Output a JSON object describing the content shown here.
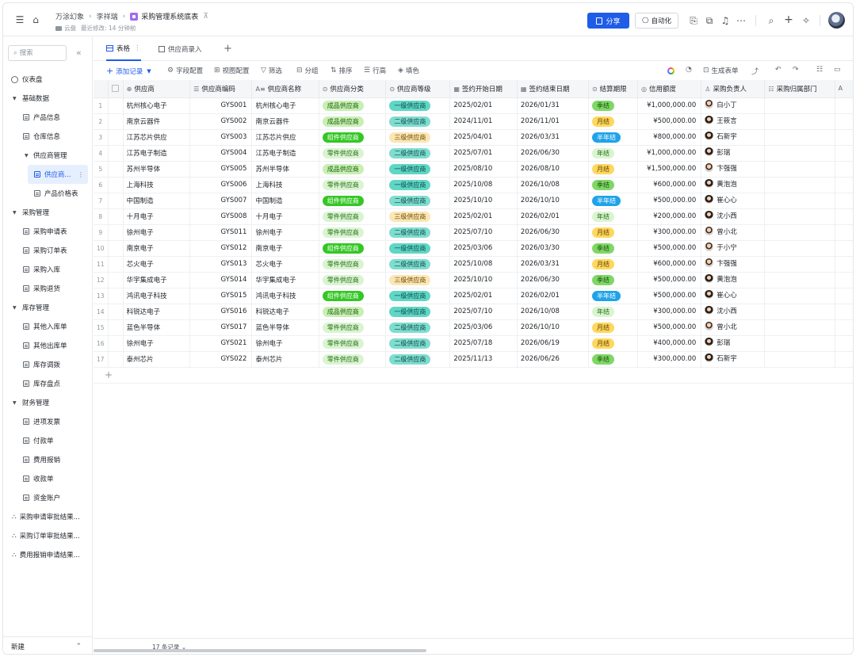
{
  "header": {
    "breadcrumbs": [
      "万涂幻象",
      "李祥瑞"
    ],
    "current": "采购管理系统底表",
    "location": "云盘",
    "last_modified": "最近修改: 14 分钟前",
    "share_label": "分享",
    "automation_label": "自动化"
  },
  "sidebar": {
    "search_placeholder": "搜索",
    "dashboard": "仪表盘",
    "groups": [
      {
        "label": "基础数据",
        "items": [
          "产品信息",
          "仓库信息"
        ],
        "subgroup": {
          "label": "供应商管理",
          "items": [
            "供应商...",
            "产品价格表"
          ]
        }
      },
      {
        "label": "采购管理",
        "items": [
          "采购申请表",
          "采购订单表",
          "采购入库",
          "采购退货"
        ]
      },
      {
        "label": "库存管理",
        "items": [
          "其他入库单",
          "其他出库单",
          "库存调拨",
          "库存盘点"
        ]
      },
      {
        "label": "财务管理",
        "items": [
          "进项发票",
          "付款单",
          "费用报销",
          "收款单",
          "资金账户"
        ]
      }
    ],
    "flows": [
      "采购申请审批结果...",
      "采购订单审批结果...",
      "费用报销申请结果..."
    ],
    "new_label": "新建"
  },
  "tabs": [
    {
      "label": "表格"
    },
    {
      "label": "供应商录入"
    }
  ],
  "toolbar": {
    "add": "添加记录",
    "field_config": "字段配置",
    "view_config": "视图配置",
    "filter": "筛选",
    "group": "分组",
    "sort": "排序",
    "row_height": "行高",
    "fill_color": "填色",
    "gen_form": "生成表单"
  },
  "columns": [
    "供应商",
    "供应商编码",
    "供应商名称",
    "供应商分类",
    "供应商等级",
    "签约开始日期",
    "签约结束日期",
    "结算期限",
    "信用额度",
    "采购负责人",
    "采购归属部门"
  ],
  "rows": [
    {
      "n": "1",
      "supplier": "杭州核心电子",
      "code": "GYS001",
      "name": "杭州核心电子",
      "cat": "成品供应商",
      "level": "一级供应商",
      "start": "2025/02/01",
      "end": "2026/01/31",
      "term": "季结",
      "credit": "¥1,000,000.00",
      "owner": "白小丁",
      "f": false
    },
    {
      "n": "2",
      "supplier": "南京云器件",
      "code": "GYS002",
      "name": "南京云器件",
      "cat": "成品供应商",
      "level": "二级供应商",
      "start": "2024/11/01",
      "end": "2026/11/01",
      "term": "月结",
      "credit": "¥500,000.00",
      "owner": "王筱言",
      "f": true
    },
    {
      "n": "3",
      "supplier": "江苏芯片供应",
      "code": "GYS003",
      "name": "江苏芯片供应",
      "cat": "组件供应商",
      "level": "三级供应商",
      "start": "2025/04/01",
      "end": "2026/03/31",
      "term": "半年结",
      "credit": "¥800,000.00",
      "owner": "石新宇",
      "f": true
    },
    {
      "n": "4",
      "supplier": "江苏电子制造",
      "code": "GYS004",
      "name": "江苏电子制造",
      "cat": "零件供应商",
      "level": "二级供应商",
      "start": "2025/07/01",
      "end": "2026/06/30",
      "term": "年结",
      "credit": "¥1,000,000.00",
      "owner": "彭瑞",
      "f": true
    },
    {
      "n": "5",
      "supplier": "苏州半导体",
      "code": "GYS005",
      "name": "苏州半导体",
      "cat": "成品供应商",
      "level": "一级供应商",
      "start": "2025/08/10",
      "end": "2026/08/10",
      "term": "月结",
      "credit": "¥1,500,000.00",
      "owner": "卞强强",
      "f": false
    },
    {
      "n": "6",
      "supplier": "上海科技",
      "code": "GYS006",
      "name": "上海科技",
      "cat": "零件供应商",
      "level": "一级供应商",
      "start": "2025/10/08",
      "end": "2026/10/08",
      "term": "季结",
      "credit": "¥600,000.00",
      "owner": "黄泡泡",
      "f": true
    },
    {
      "n": "7",
      "supplier": "中国制造",
      "code": "GYS007",
      "name": "中国制造",
      "cat": "组件供应商",
      "level": "二级供应商",
      "start": "2025/10/10",
      "end": "2026/10/10",
      "term": "半年结",
      "credit": "¥500,000.00",
      "owner": "崔心心",
      "f": true
    },
    {
      "n": "8",
      "supplier": "十月电子",
      "code": "GYS008",
      "name": "十月电子",
      "cat": "零件供应商",
      "level": "三级供应商",
      "start": "2025/02/01",
      "end": "2026/02/01",
      "term": "年结",
      "credit": "¥200,000.00",
      "owner": "沈小西",
      "f": true
    },
    {
      "n": "9",
      "supplier": "徐州电子",
      "code": "GYS011",
      "name": "徐州电子",
      "cat": "零件供应商",
      "level": "二级供应商",
      "start": "2025/07/10",
      "end": "2026/06/30",
      "term": "月结",
      "credit": "¥300,000.00",
      "owner": "曾小北",
      "f": false
    },
    {
      "n": "10",
      "supplier": "南京电子",
      "code": "GYS012",
      "name": "南京电子",
      "cat": "组件供应商",
      "level": "一级供应商",
      "start": "2025/03/06",
      "end": "2026/03/30",
      "term": "季结",
      "credit": "¥500,000.00",
      "owner": "于小宁",
      "f": false
    },
    {
      "n": "11",
      "supplier": "芯火电子",
      "code": "GYS013",
      "name": "芯火电子",
      "cat": "零件供应商",
      "level": "二级供应商",
      "start": "2025/10/08",
      "end": "2026/03/31",
      "term": "月结",
      "credit": "¥600,000.00",
      "owner": "卞强强",
      "f": false
    },
    {
      "n": "12",
      "supplier": "华宇集成电子",
      "code": "GYS014",
      "name": "华宇集成电子",
      "cat": "零件供应商",
      "level": "三级供应商",
      "start": "2025/10/10",
      "end": "2026/06/30",
      "term": "季结",
      "credit": "¥500,000.00",
      "owner": "黄泡泡",
      "f": true
    },
    {
      "n": "13",
      "supplier": "鸿讯电子科技",
      "code": "GYS015",
      "name": "鸿讯电子科技",
      "cat": "组件供应商",
      "level": "一级供应商",
      "start": "2025/02/01",
      "end": "2026/02/01",
      "term": "半年结",
      "credit": "¥500,000.00",
      "owner": "崔心心",
      "f": true
    },
    {
      "n": "14",
      "supplier": "科锐达电子",
      "code": "GYS016",
      "name": "科锐达电子",
      "cat": "成品供应商",
      "level": "一级供应商",
      "start": "2025/07/10",
      "end": "2026/10/08",
      "term": "年结",
      "credit": "¥300,000.00",
      "owner": "沈小西",
      "f": true
    },
    {
      "n": "15",
      "supplier": "蓝色半导体",
      "code": "GYS017",
      "name": "蓝色半导体",
      "cat": "零件供应商",
      "level": "二级供应商",
      "start": "2025/03/06",
      "end": "2026/10/10",
      "term": "月结",
      "credit": "¥500,000.00",
      "owner": "曾小北",
      "f": false
    },
    {
      "n": "16",
      "supplier": "徐州电子",
      "code": "GYS021",
      "name": "徐州电子",
      "cat": "零件供应商",
      "level": "二级供应商",
      "start": "2025/07/18",
      "end": "2026/06/19",
      "term": "月结",
      "credit": "¥400,000.00",
      "owner": "彭瑞",
      "f": true
    },
    {
      "n": "17",
      "supplier": "泰州芯片",
      "code": "GYS022",
      "name": "泰州芯片",
      "cat": "零件供应商",
      "level": "二级供应商",
      "start": "2025/11/13",
      "end": "2026/06/26",
      "term": "季结",
      "credit": "¥300,000.00",
      "owner": "石新宇",
      "f": true
    }
  ],
  "tag_colors": {
    "成品供应商": {
      "bg": "#c8efb4",
      "fg": "#1f5f0f"
    },
    "组件供应商": {
      "bg": "#34c724",
      "fg": "#ffffff"
    },
    "零件供应商": {
      "bg": "#d9f5d0",
      "fg": "#2a6a1a"
    },
    "一级供应商": {
      "bg": "#5fd6c6",
      "fg": "#0b4b44"
    },
    "二级供应商": {
      "bg": "#7fdcd0",
      "fg": "#0b4b44"
    },
    "三级供应商": {
      "bg": "#fbe6b4",
      "fg": "#6b4a00"
    },
    "季结": {
      "bg": "#7fd866",
      "fg": "#1f4f10"
    },
    "月结": {
      "bg": "#ffd75e",
      "fg": "#5f4500"
    },
    "半年结": {
      "bg": "#1fa3e8",
      "fg": "#ffffff"
    },
    "年结": {
      "bg": "#d9f5d0",
      "fg": "#2a6a1a"
    }
  },
  "footer": {
    "record_count": "17 条记录"
  }
}
